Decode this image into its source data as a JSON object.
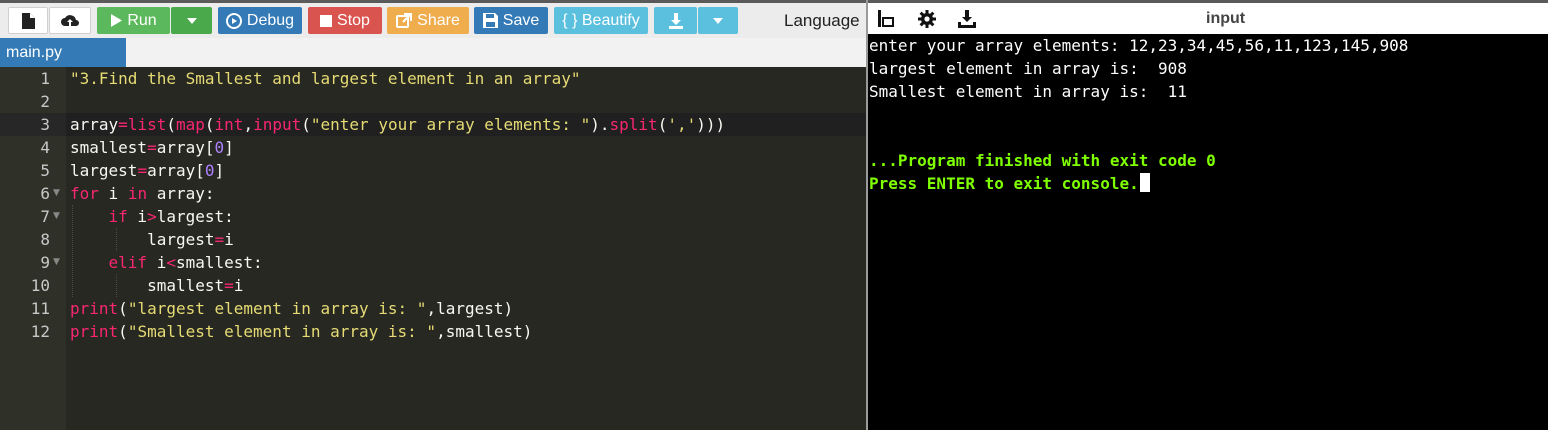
{
  "toolbar": {
    "run_label": "Run",
    "debug_label": "Debug",
    "stop_label": "Stop",
    "share_label": "Share",
    "save_label": "Save",
    "beautify_label": "{ } Beautify",
    "language_label": "Language"
  },
  "editor": {
    "tab_label": "main.py",
    "line_numbers": [
      "1",
      "2",
      "3",
      "4",
      "5",
      "6",
      "7",
      "8",
      "9",
      "10",
      "11",
      "12"
    ],
    "lines": [
      "\"3.Find the Smallest and largest element in an array\"",
      "",
      "array=list(map(int,input(\"enter your array elements: \").split(',')))",
      "smallest=array[0]",
      "largest=array[0]",
      "for i in array:",
      "    if i>largest:",
      "        largest=i",
      "    elif i<smallest:",
      "        smallest=i",
      "print(\"largest element in array is: \",largest)",
      "print(\"Smallest element in array is: \",smallest)"
    ]
  },
  "console": {
    "title": "input",
    "lines": [
      "enter your array elements: 12,23,34,45,56,11,123,145,908",
      "largest element in array is:  908",
      "Smallest element in array is:  11",
      "",
      "",
      "...Program finished with exit code 0",
      "Press ENTER to exit console."
    ]
  },
  "colors": {
    "editor_bg": "#272822",
    "string": "#e6db74",
    "keyword": "#f92672",
    "number": "#ae81ff",
    "console_bg": "#000000",
    "console_finish": "#7fff00"
  }
}
